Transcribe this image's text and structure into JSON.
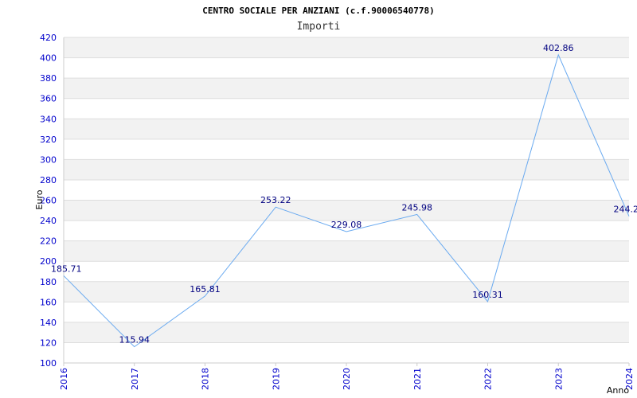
{
  "chart_data": {
    "type": "line",
    "title": "CENTRO SOCIALE PER ANZIANI (c.f.90006540778)",
    "subtitle": "Importi",
    "xlabel": "Anno",
    "ylabel": "Euro",
    "categories": [
      "2016",
      "2017",
      "2018",
      "2019",
      "2020",
      "2021",
      "2022",
      "2023",
      "2024"
    ],
    "values": [
      185.71,
      115.94,
      165.81,
      253.22,
      229.08,
      245.98,
      160.31,
      402.86,
      244.2
    ],
    "data_labels": [
      "185.71",
      "115.94",
      "165.81",
      "253.22",
      "229.08",
      "245.98",
      "160.31",
      "402.86",
      "244.2"
    ],
    "ylim": [
      100,
      420
    ],
    "yticks": [
      "100",
      "120",
      "140",
      "160",
      "180",
      "200",
      "220",
      "240",
      "260",
      "280",
      "300",
      "320",
      "340",
      "360",
      "380",
      "400",
      "420"
    ],
    "grid": true,
    "line_color": "#6aaaf0",
    "tick_color": "#0000cc",
    "band_color": "#f2f2f2"
  }
}
